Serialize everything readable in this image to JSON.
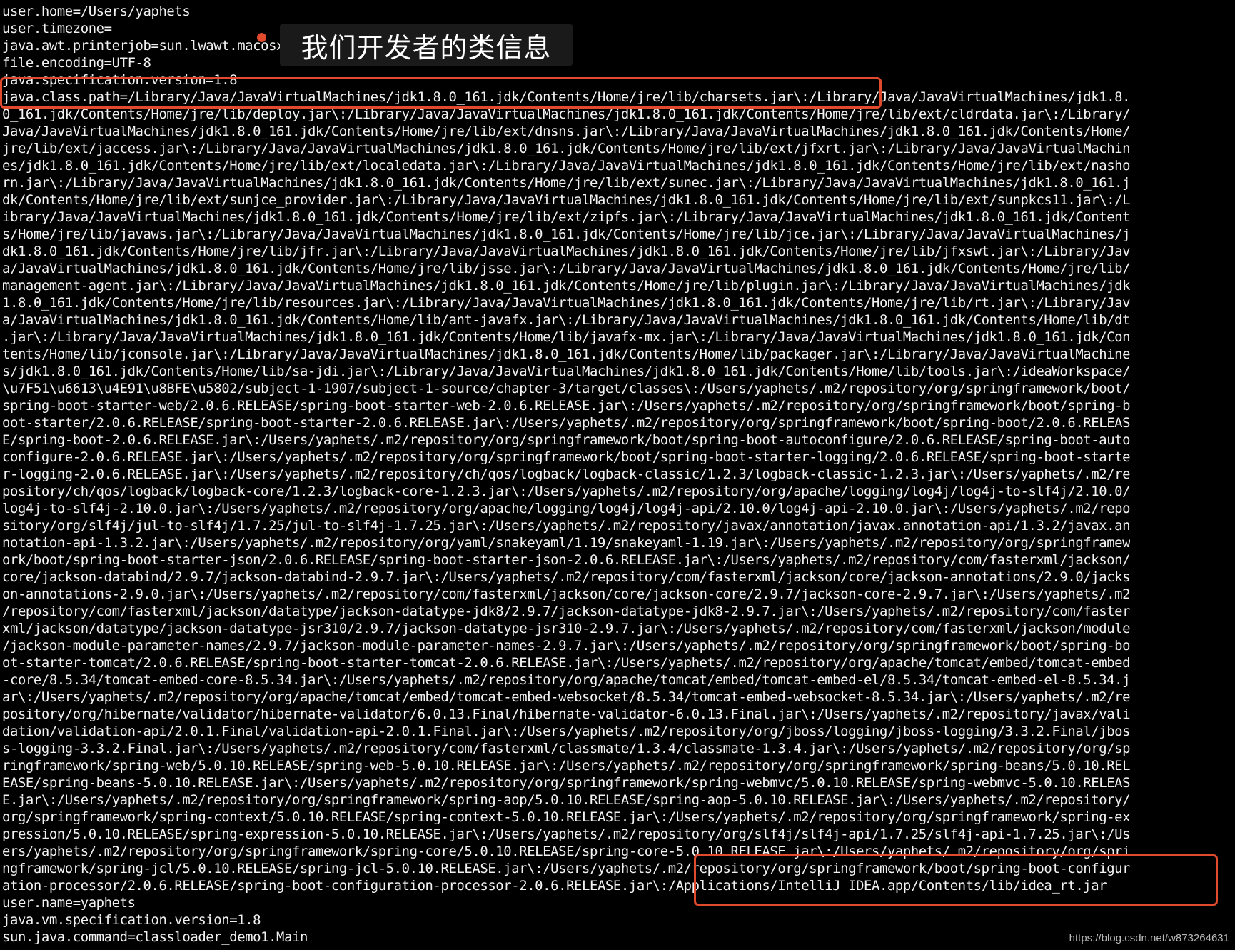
{
  "terminal": {
    "lines": [
      "user.home=/Users/yaphets",
      "user.timezone=",
      "java.awt.printerjob=sun.lwawt.macosx.CPrinterJob",
      "file.encoding=UTF-8",
      "java.specification.version=1.8",
      "java.class.path=/Library/Java/JavaVirtualMachines/jdk1.8.0_161.jdk/Contents/Home/jre/lib/charsets.jar\\:/Library/Java/JavaVirtualMachines/jdk1.8.",
      "0_161.jdk/Contents/Home/jre/lib/deploy.jar\\:/Library/Java/JavaVirtualMachines/jdk1.8.0_161.jdk/Contents/Home/jre/lib/ext/cldrdata.jar\\:/Library/",
      "Java/JavaVirtualMachines/jdk1.8.0_161.jdk/Contents/Home/jre/lib/ext/dnsns.jar\\:/Library/Java/JavaVirtualMachines/jdk1.8.0_161.jdk/Contents/Home/",
      "jre/lib/ext/jaccess.jar\\:/Library/Java/JavaVirtualMachines/jdk1.8.0_161.jdk/Contents/Home/jre/lib/ext/jfxrt.jar\\:/Library/Java/JavaVirtualMachin",
      "es/jdk1.8.0_161.jdk/Contents/Home/jre/lib/ext/localedata.jar\\:/Library/Java/JavaVirtualMachines/jdk1.8.0_161.jdk/Contents/Home/jre/lib/ext/nasho",
      "rn.jar\\:/Library/Java/JavaVirtualMachines/jdk1.8.0_161.jdk/Contents/Home/jre/lib/ext/sunec.jar\\:/Library/Java/JavaVirtualMachines/jdk1.8.0_161.j",
      "dk/Contents/Home/jre/lib/ext/sunjce_provider.jar\\:/Library/Java/JavaVirtualMachines/jdk1.8.0_161.jdk/Contents/Home/jre/lib/ext/sunpkcs11.jar\\:/L",
      "ibrary/Java/JavaVirtualMachines/jdk1.8.0_161.jdk/Contents/Home/jre/lib/ext/zipfs.jar\\:/Library/Java/JavaVirtualMachines/jdk1.8.0_161.jdk/Content",
      "s/Home/jre/lib/javaws.jar\\:/Library/Java/JavaVirtualMachines/jdk1.8.0_161.jdk/Contents/Home/jre/lib/jce.jar\\:/Library/Java/JavaVirtualMachines/j",
      "dk1.8.0_161.jdk/Contents/Home/jre/lib/jfr.jar\\:/Library/Java/JavaVirtualMachines/jdk1.8.0_161.jdk/Contents/Home/jre/lib/jfxswt.jar\\:/Library/Jav",
      "a/JavaVirtualMachines/jdk1.8.0_161.jdk/Contents/Home/jre/lib/jsse.jar\\:/Library/Java/JavaVirtualMachines/jdk1.8.0_161.jdk/Contents/Home/jre/lib/",
      "management-agent.jar\\:/Library/Java/JavaVirtualMachines/jdk1.8.0_161.jdk/Contents/Home/jre/lib/plugin.jar\\:/Library/Java/JavaVirtualMachines/jdk",
      "1.8.0_161.jdk/Contents/Home/jre/lib/resources.jar\\:/Library/Java/JavaVirtualMachines/jdk1.8.0_161.jdk/Contents/Home/jre/lib/rt.jar\\:/Library/Jav",
      "a/JavaVirtualMachines/jdk1.8.0_161.jdk/Contents/Home/lib/ant-javafx.jar\\:/Library/Java/JavaVirtualMachines/jdk1.8.0_161.jdk/Contents/Home/lib/dt",
      ".jar\\:/Library/Java/JavaVirtualMachines/jdk1.8.0_161.jdk/Contents/Home/lib/javafx-mx.jar\\:/Library/Java/JavaVirtualMachines/jdk1.8.0_161.jdk/Con",
      "tents/Home/lib/jconsole.jar\\:/Library/Java/JavaVirtualMachines/jdk1.8.0_161.jdk/Contents/Home/lib/packager.jar\\:/Library/Java/JavaVirtualMachine",
      "s/jdk1.8.0_161.jdk/Contents/Home/lib/sa-jdi.jar\\:/Library/Java/JavaVirtualMachines/jdk1.8.0_161.jdk/Contents/Home/lib/tools.jar\\:/ideaWorkspace/",
      "\\u7F51\\u6613\\u4E91\\u8BFE\\u5802/subject-1-1907/subject-1-source/chapter-3/target/classes\\:/Users/yaphets/.m2/repository/org/springframework/boot/",
      "spring-boot-starter-web/2.0.6.RELEASE/spring-boot-starter-web-2.0.6.RELEASE.jar\\:/Users/yaphets/.m2/repository/org/springframework/boot/spring-b",
      "oot-starter/2.0.6.RELEASE/spring-boot-starter-2.0.6.RELEASE.jar\\:/Users/yaphets/.m2/repository/org/springframework/boot/spring-boot/2.0.6.RELEAS",
      "E/spring-boot-2.0.6.RELEASE.jar\\:/Users/yaphets/.m2/repository/org/springframework/boot/spring-boot-autoconfigure/2.0.6.RELEASE/spring-boot-auto",
      "configure-2.0.6.RELEASE.jar\\:/Users/yaphets/.m2/repository/org/springframework/boot/spring-boot-starter-logging/2.0.6.RELEASE/spring-boot-starte",
      "r-logging-2.0.6.RELEASE.jar\\:/Users/yaphets/.m2/repository/ch/qos/logback/logback-classic/1.2.3/logback-classic-1.2.3.jar\\:/Users/yaphets/.m2/re",
      "pository/ch/qos/logback/logback-core/1.2.3/logback-core-1.2.3.jar\\:/Users/yaphets/.m2/repository/org/apache/logging/log4j/log4j-to-slf4j/2.10.0/",
      "log4j-to-slf4j-2.10.0.jar\\:/Users/yaphets/.m2/repository/org/apache/logging/log4j/log4j-api/2.10.0/log4j-api-2.10.0.jar\\:/Users/yaphets/.m2/repo",
      "sitory/org/slf4j/jul-to-slf4j/1.7.25/jul-to-slf4j-1.7.25.jar\\:/Users/yaphets/.m2/repository/javax/annotation/javax.annotation-api/1.3.2/javax.an",
      "notation-api-1.3.2.jar\\:/Users/yaphets/.m2/repository/org/yaml/snakeyaml/1.19/snakeyaml-1.19.jar\\:/Users/yaphets/.m2/repository/org/springframew",
      "ork/boot/spring-boot-starter-json/2.0.6.RELEASE/spring-boot-starter-json-2.0.6.RELEASE.jar\\:/Users/yaphets/.m2/repository/com/fasterxml/jackson/",
      "core/jackson-databind/2.9.7/jackson-databind-2.9.7.jar\\:/Users/yaphets/.m2/repository/com/fasterxml/jackson/core/jackson-annotations/2.9.0/jacks",
      "on-annotations-2.9.0.jar\\:/Users/yaphets/.m2/repository/com/fasterxml/jackson/core/jackson-core/2.9.7/jackson-core-2.9.7.jar\\:/Users/yaphets/.m2",
      "/repository/com/fasterxml/jackson/datatype/jackson-datatype-jdk8/2.9.7/jackson-datatype-jdk8-2.9.7.jar\\:/Users/yaphets/.m2/repository/com/faster",
      "xml/jackson/datatype/jackson-datatype-jsr310/2.9.7/jackson-datatype-jsr310-2.9.7.jar\\:/Users/yaphets/.m2/repository/com/fasterxml/jackson/module",
      "/jackson-module-parameter-names/2.9.7/jackson-module-parameter-names-2.9.7.jar\\:/Users/yaphets/.m2/repository/org/springframework/boot/spring-bo",
      "ot-starter-tomcat/2.0.6.RELEASE/spring-boot-starter-tomcat-2.0.6.RELEASE.jar\\:/Users/yaphets/.m2/repository/org/apache/tomcat/embed/tomcat-embed",
      "-core/8.5.34/tomcat-embed-core-8.5.34.jar\\:/Users/yaphets/.m2/repository/org/apache/tomcat/embed/tomcat-embed-el/8.5.34/tomcat-embed-el-8.5.34.j",
      "ar\\:/Users/yaphets/.m2/repository/org/apache/tomcat/embed/tomcat-embed-websocket/8.5.34/tomcat-embed-websocket-8.5.34.jar\\:/Users/yaphets/.m2/re",
      "pository/org/hibernate/validator/hibernate-validator/6.0.13.Final/hibernate-validator-6.0.13.Final.jar\\:/Users/yaphets/.m2/repository/javax/vali",
      "dation/validation-api/2.0.1.Final/validation-api-2.0.1.Final.jar\\:/Users/yaphets/.m2/repository/org/jboss/logging/jboss-logging/3.3.2.Final/jbos",
      "s-logging-3.3.2.Final.jar\\:/Users/yaphets/.m2/repository/com/fasterxml/classmate/1.3.4/classmate-1.3.4.jar\\:/Users/yaphets/.m2/repository/org/sp",
      "ringframework/spring-web/5.0.10.RELEASE/spring-web-5.0.10.RELEASE.jar\\:/Users/yaphets/.m2/repository/org/springframework/spring-beans/5.0.10.REL",
      "EASE/spring-beans-5.0.10.RELEASE.jar\\:/Users/yaphets/.m2/repository/org/springframework/spring-webmvc/5.0.10.RELEASE/spring-webmvc-5.0.10.RELEAS",
      "E.jar\\:/Users/yaphets/.m2/repository/org/springframework/spring-aop/5.0.10.RELEASE/spring-aop-5.0.10.RELEASE.jar\\:/Users/yaphets/.m2/repository/",
      "org/springframework/spring-context/5.0.10.RELEASE/spring-context-5.0.10.RELEASE.jar\\:/Users/yaphets/.m2/repository/org/springframework/spring-ex",
      "pression/5.0.10.RELEASE/spring-expression-5.0.10.RELEASE.jar\\:/Users/yaphets/.m2/repository/org/slf4j/slf4j-api/1.7.25/slf4j-api-1.7.25.jar\\:/Us",
      "ers/yaphets/.m2/repository/org/springframework/spring-core/5.0.10.RELEASE/spring-core-5.0.10.RELEASE.jar\\:/Users/yaphets/.m2/repository/org/spri",
      "ngframework/spring-jcl/5.0.10.RELEASE/spring-jcl-5.0.10.RELEASE.jar\\:/Users/yaphets/.m2/repository/org/springframework/boot/spring-boot-configur",
      "ation-processor/2.0.6.RELEASE/spring-boot-configuration-processor-2.0.6.RELEASE.jar\\:/Applications/IntelliJ IDEA.app/Contents/lib/idea_rt.jar",
      "user.name=yaphets",
      "java.vm.specification.version=1.8",
      "sun.java.command=classloader_demo1.Main"
    ]
  },
  "annotation": {
    "label": "我们开发者的类信息",
    "accent_color": "#e14a2c"
  },
  "watermark": "https://blog.csdn.net/w873264631"
}
